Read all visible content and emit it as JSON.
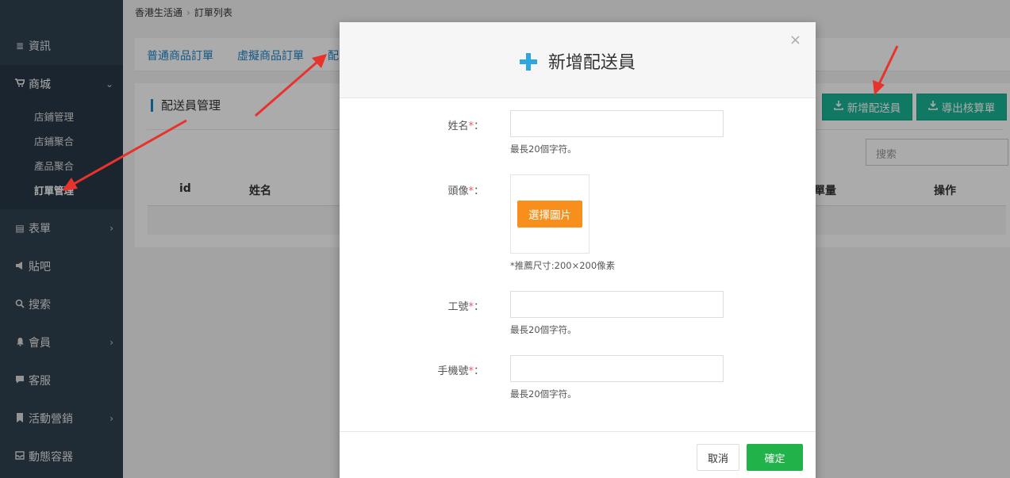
{
  "sidebar": {
    "items": [
      {
        "icon": "list-icon",
        "glyph": "≣",
        "label": "資訊"
      },
      {
        "icon": "cart-icon",
        "glyph": "🛒",
        "label": "商城"
      },
      {
        "icon": "form-icon",
        "glyph": "▤",
        "label": "表單"
      },
      {
        "icon": "megaphone-icon",
        "glyph": "📢",
        "label": "貼吧"
      },
      {
        "icon": "search-icon",
        "glyph": "⚲",
        "label": "搜索"
      },
      {
        "icon": "bell-icon",
        "glyph": "🔔",
        "label": "會員"
      },
      {
        "icon": "comment-icon",
        "glyph": "💬",
        "label": "客服"
      },
      {
        "icon": "bookmark-icon",
        "glyph": "🔖",
        "label": "活動營銷"
      },
      {
        "icon": "inbox-icon",
        "glyph": "📥",
        "label": "動態容器"
      }
    ],
    "sub_items": [
      "店鋪管理",
      "店鋪聚合",
      "產品聚合",
      "訂單管理"
    ]
  },
  "breadcrumb": {
    "root": "香港生活通",
    "current": "訂單列表"
  },
  "tabs": [
    "普通商品訂單",
    "虛擬商品訂單",
    "配"
  ],
  "panel": {
    "title": "配送員管理",
    "add_button": "新增配送員",
    "export_button": "導出核算單",
    "search_placeholder": "搜索",
    "columns": {
      "id": "id",
      "name": "姓名",
      "count": "單量",
      "action": "操作"
    }
  },
  "modal": {
    "title": "新增配送員",
    "close": "×",
    "fields": {
      "name_label": "姓名",
      "avatar_label": "頭像",
      "job_label": "工號",
      "phone_label": "手機號",
      "required_mark": "*",
      "colon": "："
    },
    "help_20chars": "最長20個字符。",
    "choose_image": "選擇圖片",
    "image_hint": "*推薦尺寸:200×200像素",
    "cancel": "取消",
    "confirm": "確定"
  },
  "colors": {
    "sidebar": "#2f4050",
    "accent_blue": "#1c84c6",
    "green": "#1ab394",
    "orange": "#f88f1c",
    "arrow_red": "#e8322c"
  }
}
